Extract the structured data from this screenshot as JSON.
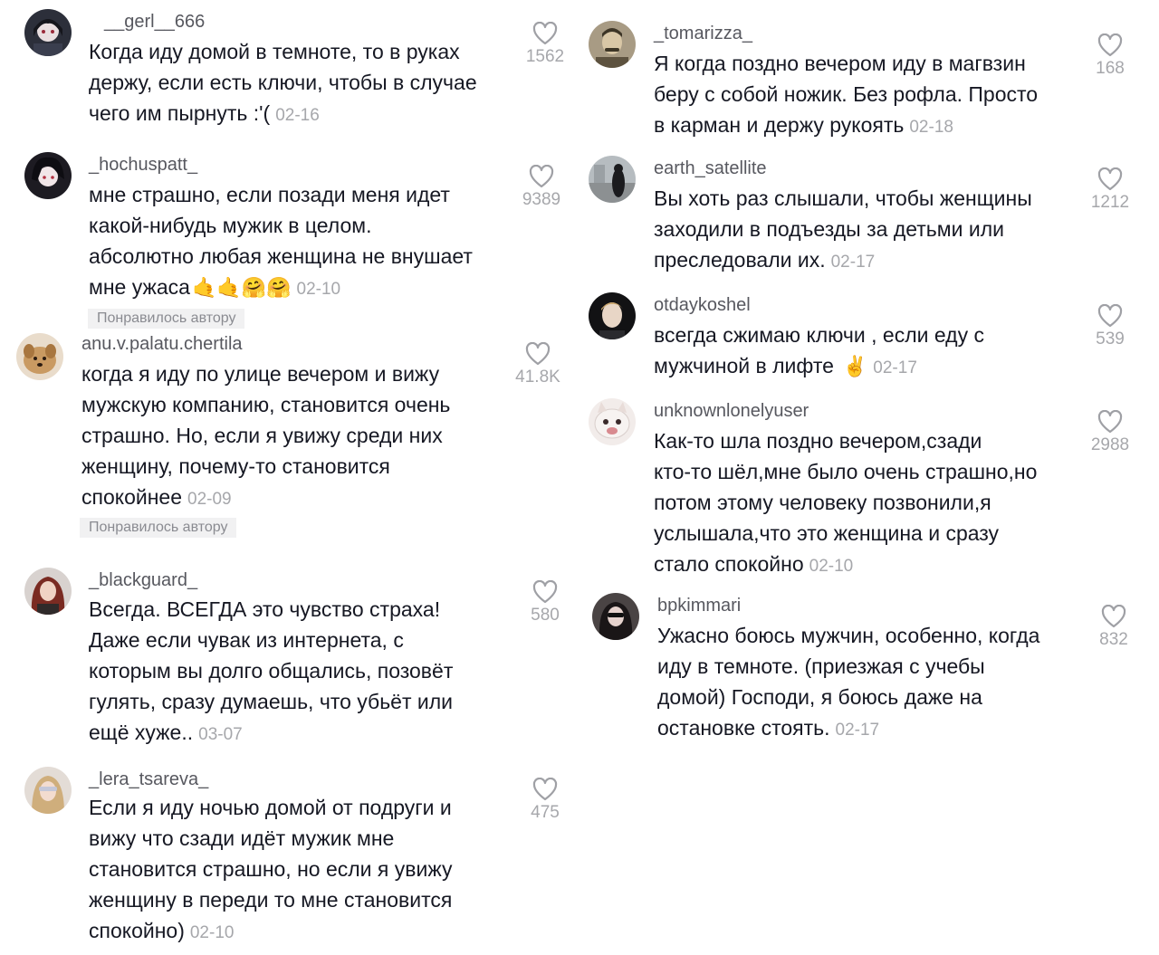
{
  "left": [
    {
      "username": "__gerl__666",
      "lines": [
        "Когда иду домой в темноте, то в руках",
        "держу, если есть ключи, чтобы в случае",
        "чего им пырнуть :'("
      ],
      "date": "02-16",
      "likes": "1562",
      "avatar": "avatar-anime-dark"
    },
    {
      "username": "_hochuspatt_",
      "lines": [
        "мне страшно, если позади меня идет",
        "какой-нибудь мужик в целом.",
        "абсолютно любая женщина не внушает",
        "мне ужаса"
      ],
      "emojis": "🤙🤙🤗🤗",
      "date": "02-10",
      "likes": "9389",
      "badge": "Понравилось автору",
      "avatar": "avatar-anime-girl"
    },
    {
      "username": "anu.v.palatu.chertila",
      "lines": [
        "когда я иду по улице вечером и вижу",
        "мужскую компанию, становится очень",
        "страшно. Но, если я увижу среди них",
        "женщину, почему-то становится",
        "спокойнее"
      ],
      "date": "02-09",
      "likes": "41.8K",
      "badge": "Понравилось автору",
      "avatar": "avatar-dog"
    },
    {
      "username": "_blackguard_",
      "lines": [
        "Всегда. ВСЕГДА это чувство страха!",
        "Даже если чувак из интернета, с",
        "которым вы долго общались, позовёт",
        "гулять, сразу думаешь, что убьёт или",
        "ещё хуже.."
      ],
      "date": "03-07",
      "likes": "580",
      "avatar": "avatar-girl-redhair"
    },
    {
      "username": "_lera_tsareva_",
      "lines": [
        "Если я иду ночью домой от подруги и",
        "вижу что сзади идёт мужик мне",
        "становится страшно, но если я увижу",
        "женщину в переди то мне становится",
        "спокойно)"
      ],
      "date": "02-10",
      "likes": "475",
      "avatar": "avatar-girl-blond"
    }
  ],
  "right": [
    {
      "username": "_tomarizza_",
      "lines": [
        "Я когда поздно вечером иду в магвзин",
        "беру с собой ножик. Без рофла. Просто",
        "в карман и держу рукоять"
      ],
      "date": "02-18",
      "likes": "168",
      "avatar": "avatar-vintage-man"
    },
    {
      "username": "earth_satellite",
      "lines": [
        "Вы хоть раз слышали, чтобы женщины",
        "заходили в подъезды за детьми или",
        "преследовали их."
      ],
      "date": "02-17",
      "likes": "1212",
      "avatar": "avatar-figure-outdoors"
    },
    {
      "username": "otdaykoshel",
      "lines": [
        "всегда сжимаю ключи , если еду с",
        "мужчиной в лифте"
      ],
      "emojis": "✌️",
      "date": "02-17",
      "likes": "539",
      "avatar": "avatar-man-portrait"
    },
    {
      "username": "unknownlonelyuser",
      "lines": [
        "Как-то шла поздно вечером,сзади",
        "кто-то шёл,мне было очень страшно,но",
        "потом этому человеку позвонили,я",
        "услышала,что это женщина и сразу",
        "стало спокойно"
      ],
      "date": "02-10",
      "likes": "2988",
      "avatar": "avatar-cat-meme"
    },
    {
      "username": "bpkimmari",
      "lines": [
        "Ужасно боюсь мужчин, особенно, когда",
        "иду в темноте. (приезжая с учебы",
        "домой) Господи, я боюсь даже на",
        "остановке стоять."
      ],
      "date": "02-17",
      "likes": "832",
      "avatar": "avatar-girl-dark"
    }
  ],
  "colors": {
    "text": "#161823",
    "username": "#57585f",
    "meta": "#a6a7ab",
    "badge_bg": "#f1f1f2"
  }
}
